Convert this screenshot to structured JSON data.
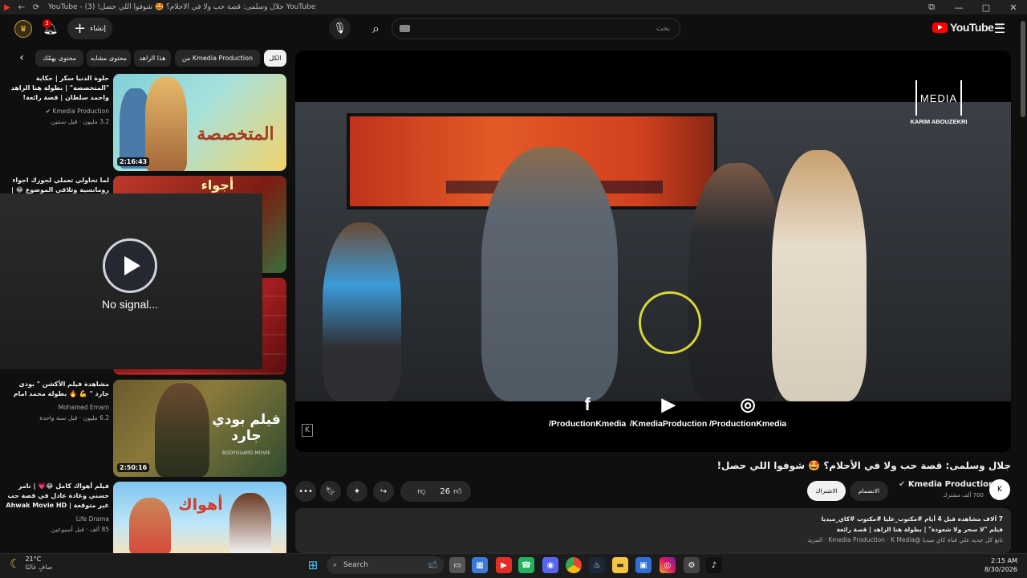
{
  "window": {
    "title": "YouTube - جلال وسلمى: قصة حب ولا في الأحلام؟ 🤩 شوفوا اللي حصل! (3) YouTube",
    "minimize": "—",
    "maximize": "□",
    "close": "✕"
  },
  "header": {
    "notification_count": "3",
    "create_label": "إنشاء",
    "search_placeholder": "بحث",
    "logo_text": "YouTube",
    "logo_region": "EG"
  },
  "chips": [
    {
      "label": "الكل"
    },
    {
      "label": "من Kmedia Production"
    },
    {
      "label": "هذا الزاهد"
    },
    {
      "label": "محتوى مشابه"
    },
    {
      "label": "محتوى يهمّك"
    }
  ],
  "sidebar_videos": [
    {
      "title": "حلوة الدنيا سكر | حكاية \"المتخصصة\" | بطولة هنا الزاهد واحمد سلطان | قصة رائعة!",
      "channel": "Kmedia Production",
      "meta": "3.2 مليون · قبل سنتين",
      "duration": "2:16:43",
      "thumb_text": "المتخصصة"
    },
    {
      "title": "لما تحاولي تعملي لجوزك اجواء رومانسية وتلاقي الموضوع 😂 | مشاهد",
      "channel": "",
      "meta": "",
      "duration": "",
      "thumb_text": "أجواء"
    },
    {
      "title": "",
      "channel": "",
      "meta": "",
      "duration": "",
      "thumb_text": ""
    },
    {
      "title": "مشاهدة فيلم الأكشن \" بودي جارد \" 💪 🔥 بطولة محمد امام",
      "channel": "Mohamed Emam",
      "meta": "6.2 مليون · قبل سنة واحدة",
      "duration": "2:50:16",
      "thumb_text": "فيلم بودي جارد",
      "thumb_sub": "BODYGUARD MOVIE"
    },
    {
      "title": "فيلم أهواك كامل 😂💗 | تامر حسني وغادة عادل في قصة حب غير متوقعة | Ahwak Movie HD",
      "channel": "Life Drama",
      "meta": "85 ألف · قبل أسبوعين",
      "duration": "",
      "thumb_text": "أهواك"
    }
  ],
  "overlay": {
    "text": "No signal..."
  },
  "player": {
    "brand": "MEDIA",
    "brand_caption": "KARIM ABOUZEKRI",
    "socials": [
      {
        "icon": "facebook-icon",
        "glyph": "f",
        "label": "/ProductionKmedia"
      },
      {
        "icon": "youtube-icon",
        "glyph": "▶",
        "label": "/KmediaProduction"
      },
      {
        "icon": "instagram-icon",
        "glyph": "◎",
        "label": "/ProductionKmedia"
      }
    ]
  },
  "video": {
    "title": "جلال وسلمى: قصة حب ولا في الأحلام؟ 🤩 شوفوا اللي حصل!",
    "channel": "Kmedia Production",
    "subscribers": "700 ألف مشترك",
    "join_label": "الانضمام",
    "subscribe_label": "الاشتراك",
    "likes": "26",
    "description_line1": "7 آلاف مشاهدة قبل 4 أيام #مكتوب_عليا #مكتوب #كاي_ميديا",
    "description_line2": "فيلم \"لا سحر ولا شعوذة\" | بطولة هنا الزاهد | قصة رائعة",
    "description_line3": "تابع كل جديد علي قناة كاي ميديا @Kmedia Production · K Media · المزيد"
  },
  "taskbar": {
    "weather_temp": "21°C",
    "weather_desc": "صافٍ غالبًا",
    "search_label": "Search",
    "time": "2:15 AM",
    "date": "8/30/2026"
  }
}
